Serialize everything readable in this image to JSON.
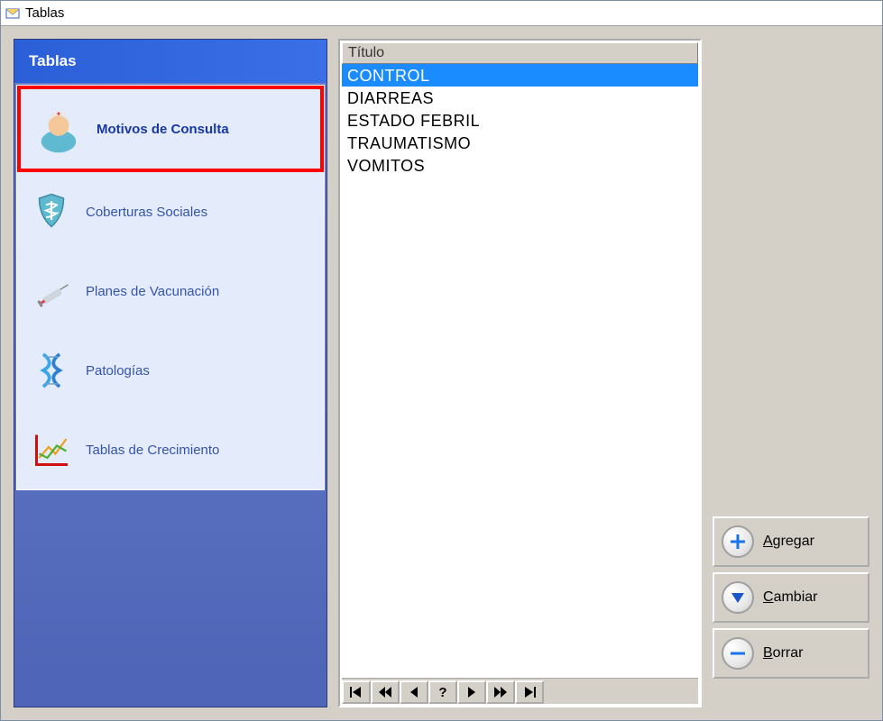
{
  "window": {
    "title": "Tablas",
    "app_icon": "envelope-icon"
  },
  "sidebar": {
    "header": "Tablas",
    "items": [
      {
        "label": "Motivos de Consulta",
        "icon": "nurse-icon",
        "selected": true
      },
      {
        "label": "Coberturas Sociales",
        "icon": "shield-caduceus-icon",
        "selected": false
      },
      {
        "label": "Planes de Vacunación",
        "icon": "syringe-icon",
        "selected": false
      },
      {
        "label": "Patologías",
        "icon": "dna-icon",
        "selected": false
      },
      {
        "label": "Tablas de Crecimiento",
        "icon": "growth-chart-icon",
        "selected": false
      }
    ]
  },
  "main": {
    "column_header": "Título",
    "rows": [
      {
        "value": "CONTROL",
        "selected": true
      },
      {
        "value": "DIARREAS",
        "selected": false
      },
      {
        "value": "ESTADO FEBRIL",
        "selected": false
      },
      {
        "value": "TRAUMATISMO",
        "selected": false
      },
      {
        "value": "VOMITOS",
        "selected": false
      }
    ],
    "nav": {
      "first": "|◀",
      "fast_back": "◀◀",
      "back": "◀",
      "query": "?",
      "forward": "▶",
      "fast_forward": "▶▶",
      "last": "▶|"
    }
  },
  "actions": {
    "add": {
      "label": "Agregar",
      "hotkey": "A",
      "icon": "plus-icon",
      "color": "#1a73e8"
    },
    "edit": {
      "label": "Cambiar",
      "hotkey": "C",
      "icon": "triangle-down-icon",
      "color": "#1a57c8"
    },
    "delete": {
      "label": "Borrar",
      "hotkey": "B",
      "icon": "minus-icon",
      "color": "#1a73e8"
    }
  }
}
